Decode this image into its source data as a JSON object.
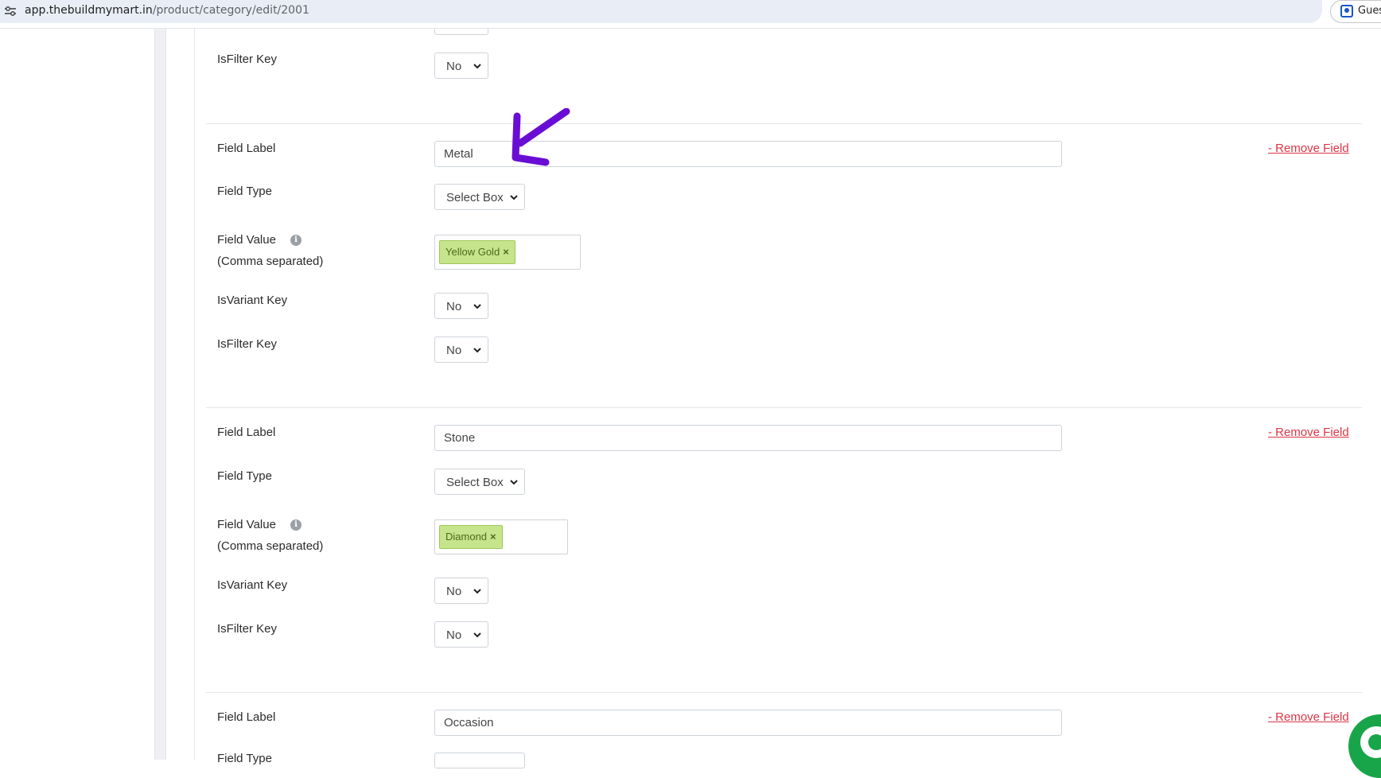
{
  "browser": {
    "url_host": "app.thebuildmymart.in",
    "url_path": "/product/category/edit/2001",
    "profile_label": "Guest"
  },
  "top_partial": {
    "isfilter_label": "IsFilter Key",
    "isfilter_value": "No"
  },
  "fields": [
    {
      "field_label_text": "Field Label",
      "field_label_value": "Metal",
      "remove_text": "- Remove Field",
      "field_type_text": "Field Type",
      "field_type_value": "Select Box",
      "field_value_text": "Field Value",
      "field_value_sub": "(Comma separated)",
      "tags": [
        "Yellow Gold"
      ],
      "isvariant_text": "IsVariant Key",
      "isvariant_value": "No",
      "isfilter_text": "IsFilter Key",
      "isfilter_value": "No"
    },
    {
      "field_label_text": "Field Label",
      "field_label_value": "Stone",
      "remove_text": "- Remove Field",
      "field_type_text": "Field Type",
      "field_type_value": "Select Box",
      "field_value_text": "Field Value",
      "field_value_sub": "(Comma separated)",
      "tags": [
        "Diamond"
      ],
      "isvariant_text": "IsVariant Key",
      "isvariant_value": "No",
      "isfilter_text": "IsFilter Key",
      "isfilter_value": "No"
    },
    {
      "field_label_text": "Field Label",
      "field_label_value": "Occasion",
      "remove_text": "- Remove Field",
      "field_type_text": "Field Type"
    }
  ],
  "tag_remove_glyph": "×",
  "info_glyph": "i",
  "colors": {
    "tag_bg": "#c6e48b",
    "remove_link": "#dc3545",
    "annotation_arrow": "#6a0dd4",
    "chat_button": "#18a54a"
  }
}
